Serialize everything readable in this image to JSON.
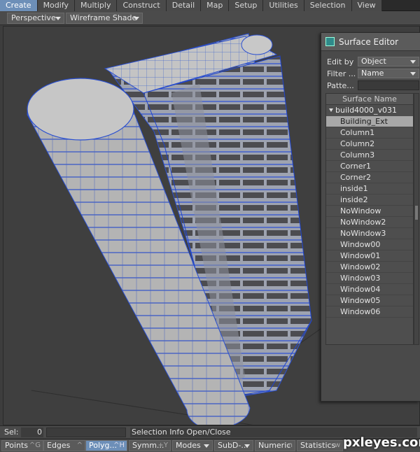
{
  "tabs": [
    "Create",
    "Modify",
    "Multiply",
    "Construct",
    "Detail",
    "Map",
    "Setup",
    "Utilities",
    "Selection",
    "View"
  ],
  "active_tab": "Create",
  "viewport": {
    "view_mode": "Perspective",
    "render_mode": "Wireframe Shade"
  },
  "surface_editor": {
    "title": "Surface Editor",
    "edit_by_label": "Edit by",
    "edit_by_value": "Object",
    "filter_label": "Filter ...",
    "filter_value": "Name",
    "pattern_label": "Patte...",
    "pattern_value": "",
    "list_header": "Surface Name",
    "root": "build4000_v031",
    "items": [
      "Building_Ext",
      "Column1",
      "Column2",
      "Column3",
      "Corner1",
      "Corner2",
      "inside1",
      "inside2",
      "NoWindow",
      "NoWindow2",
      "NoWindow3",
      "Window00",
      "Window01",
      "Window02",
      "Window03",
      "Window04",
      "Window05",
      "Window06"
    ],
    "selected": "Building_Ext"
  },
  "selbar": {
    "label": "Sel:",
    "count": "0",
    "info": "Selection Info Open/Close"
  },
  "modebar": {
    "points": "Points",
    "points_sc": "^G",
    "edges": "Edges",
    "edges_sc": "^",
    "polygons": "Polyg...",
    "polygons_sc": "^H",
    "symmetry": "Symm...",
    "symmetry_sc": "+Y",
    "modes": "Modes",
    "subd": "SubD-...",
    "numeric": "Numeric",
    "numeric_sc": "n",
    "statistics": "Statistics",
    "statistics_sc": "w"
  },
  "watermark": "pxleyes.com",
  "colors": {
    "active_tab": "#6d8fb8",
    "wire": "#3a5fd0",
    "surface": "#b8b8b8"
  }
}
